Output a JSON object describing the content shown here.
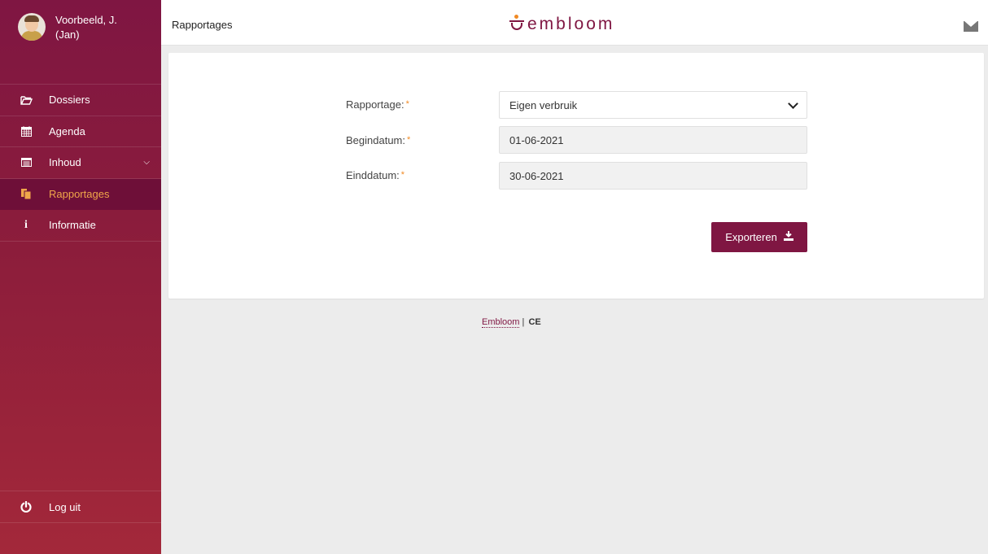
{
  "user": {
    "name": "Voorbeeld, J. (Jan)"
  },
  "sidebar": {
    "items": [
      {
        "label": "Dossiers",
        "icon": "folder-open-icon"
      },
      {
        "label": "Agenda",
        "icon": "calendar-icon"
      },
      {
        "label": "Inhoud",
        "icon": "list-icon"
      },
      {
        "label": "Rapportages",
        "icon": "report-icon",
        "active": true
      },
      {
        "label": "Informatie",
        "icon": "info-icon"
      }
    ],
    "logout": "Log uit"
  },
  "header": {
    "title": "Rapportages",
    "logo": "embloom"
  },
  "form": {
    "report_label": "Rapportage:",
    "report_value": "Eigen verbruik",
    "start_label": "Begindatum:",
    "start_value": "01-06-2021",
    "end_label": "Einddatum:",
    "end_value": "30-06-2021",
    "required_mark": "*",
    "export_label": "Exporteren"
  },
  "footer": {
    "link": "Embloom",
    "separator": "|",
    "mark": "CE"
  },
  "colors": {
    "brand": "#7f1642",
    "accent": "#f08a24",
    "active_bg": "#6e0f38"
  }
}
